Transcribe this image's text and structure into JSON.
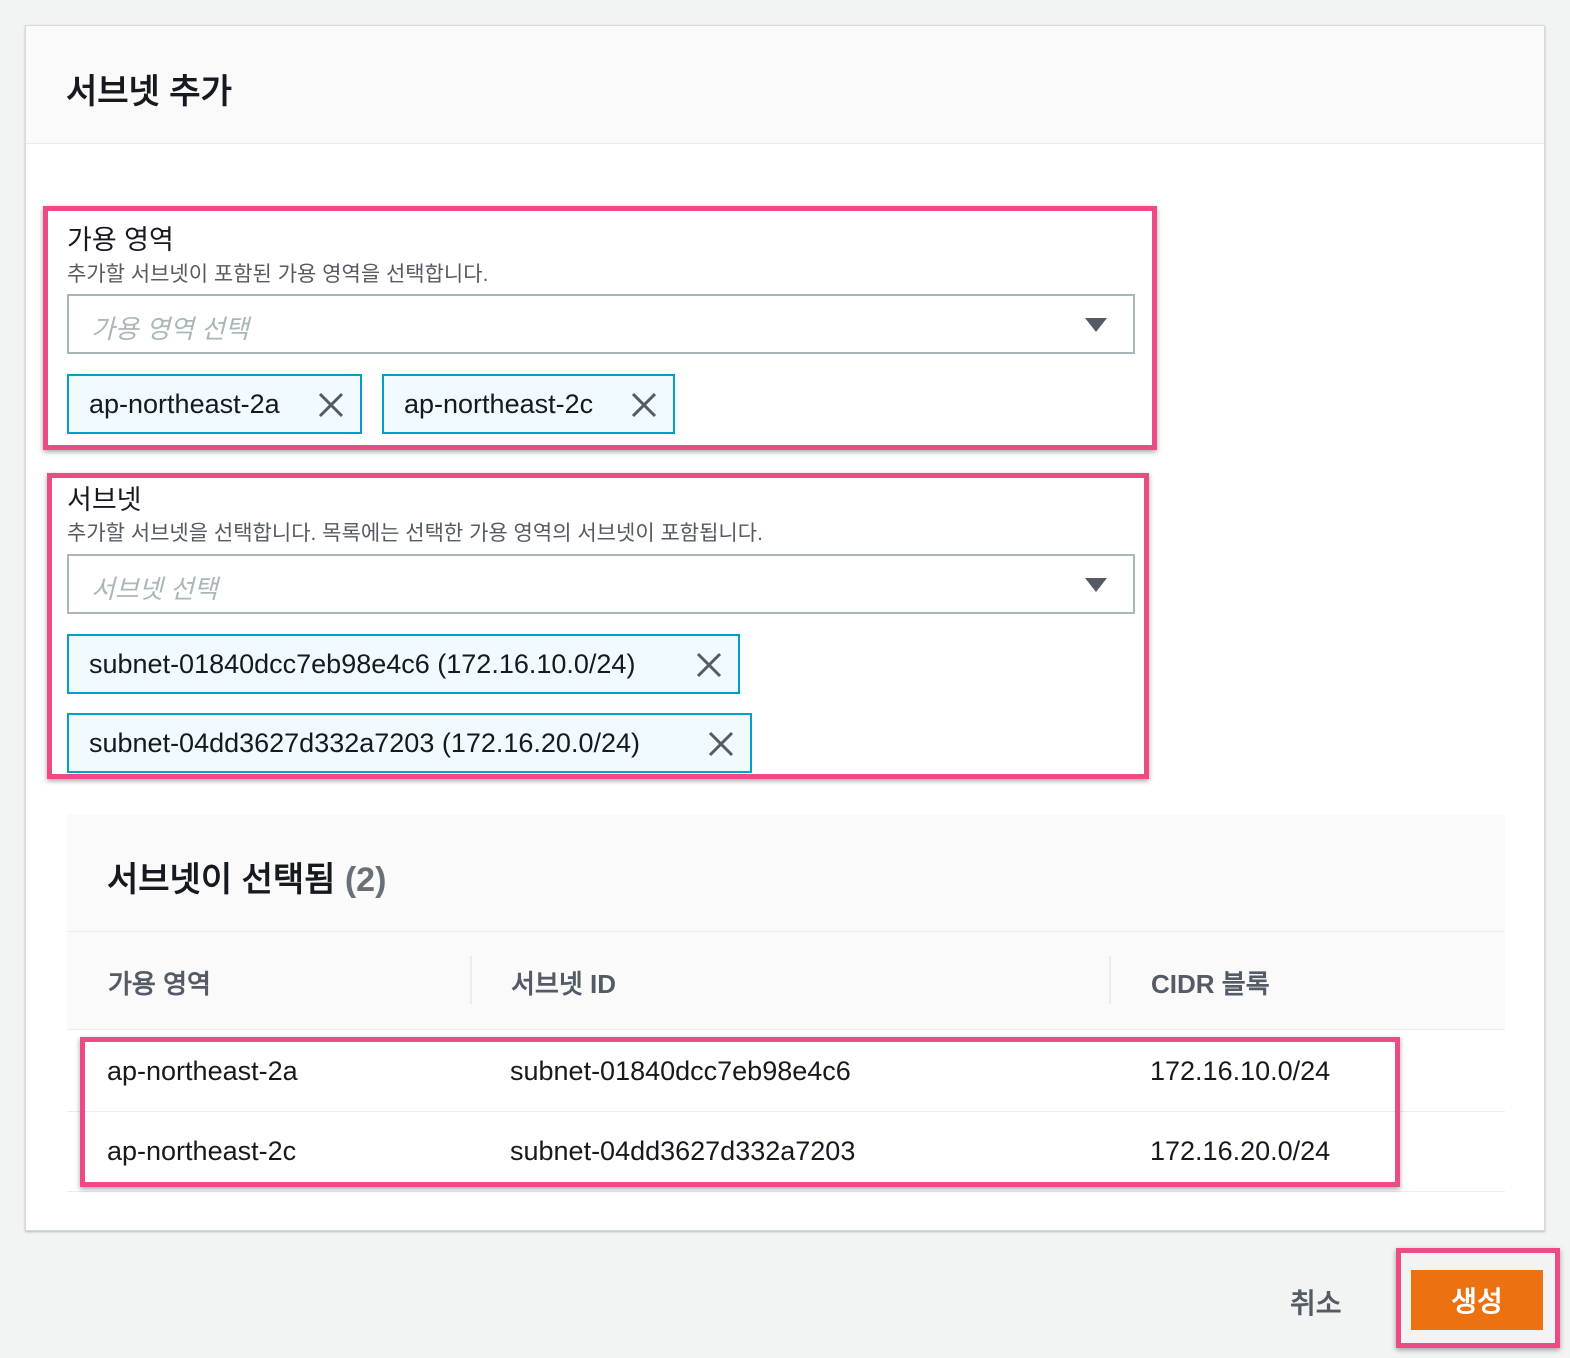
{
  "panel": {
    "title": "서브넷 추가"
  },
  "az_field": {
    "label": "가용 영역",
    "description": "추가할 서브넷이 포함된 가용 영역을 선택합니다.",
    "placeholder": "가용 영역 선택",
    "tokens": [
      "ap-northeast-2a",
      "ap-northeast-2c"
    ]
  },
  "subnet_field": {
    "label": "서브넷",
    "description": "추가할 서브넷을 선택합니다. 목록에는 선택한 가용 영역의 서브넷이 포함됩니다.",
    "placeholder": "서브넷 선택",
    "tokens": [
      "subnet-01840dcc7eb98e4c6 (172.16.10.0/24)",
      "subnet-04dd3627d332a7203 (172.16.20.0/24)"
    ]
  },
  "selected_table": {
    "title": "서브넷이 선택됨",
    "count": "(2)",
    "columns": [
      "가용 영역",
      "서브넷 ID",
      "CIDR 블록"
    ],
    "rows": [
      [
        "ap-northeast-2a",
        "subnet-01840dcc7eb98e4c6",
        "172.16.10.0/24"
      ],
      [
        "ap-northeast-2c",
        "subnet-04dd3627d332a7203",
        "172.16.20.0/24"
      ]
    ]
  },
  "footer": {
    "cancel_label": "취소",
    "create_label": "생성"
  },
  "colors": {
    "primary_button": "#ec7211",
    "token_border": "#00a1c9",
    "token_background": "#f1faff",
    "highlight": "#ec4b86"
  },
  "icons": {
    "dismiss": "close-icon",
    "caret": "caret-down-icon"
  }
}
